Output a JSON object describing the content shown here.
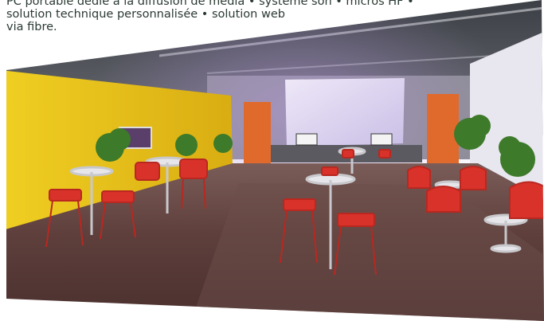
{
  "caption": {
    "line1": "PC portable dédié à la diffusion de média • système son • micros HF •",
    "line2": "solution technique personnalisée • solution web",
    "line3": "via fibre."
  },
  "photo": {
    "subject": "event-hall-interior",
    "screen_label_left": "",
    "screen_label_right": ""
  },
  "colors": {
    "yellow_wall": "#e8c21c",
    "orange_banner": "#e06a2c",
    "red_chair": "#d8322a",
    "floor": "#6a4a44",
    "ceiling": "#4e5258",
    "projection_screen": "#ddd6f0"
  }
}
